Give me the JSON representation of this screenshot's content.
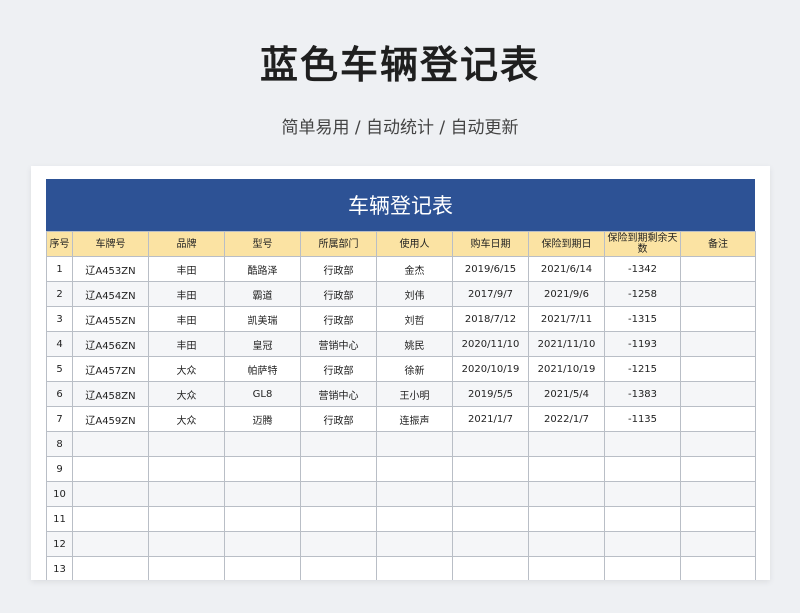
{
  "page": {
    "title": "蓝色车辆登记表",
    "subtitle": "简单易用 / 自动统计 / 自动更新"
  },
  "sheet": {
    "banner": "车辆登记表",
    "headers": [
      "序号",
      "车牌号",
      "品牌",
      "型号",
      "所属部门",
      "使用人",
      "购车日期",
      "保险到期日",
      "保险到期剩余天数",
      "备注"
    ],
    "rows": [
      [
        "1",
        "辽A453ZN",
        "丰田",
        "酷路泽",
        "行政部",
        "金杰",
        "2019/6/15",
        "2021/6/14",
        "-1342",
        ""
      ],
      [
        "2",
        "辽A454ZN",
        "丰田",
        "霸道",
        "行政部",
        "刘伟",
        "2017/9/7",
        "2021/9/6",
        "-1258",
        ""
      ],
      [
        "3",
        "辽A455ZN",
        "丰田",
        "凯美瑞",
        "行政部",
        "刘哲",
        "2018/7/12",
        "2021/7/11",
        "-1315",
        ""
      ],
      [
        "4",
        "辽A456ZN",
        "丰田",
        "皇冠",
        "营销中心",
        "姚民",
        "2020/11/10",
        "2021/11/10",
        "-1193",
        ""
      ],
      [
        "5",
        "辽A457ZN",
        "大众",
        "帕萨特",
        "行政部",
        "徐新",
        "2020/10/19",
        "2021/10/19",
        "-1215",
        ""
      ],
      [
        "6",
        "辽A458ZN",
        "大众",
        "GL8",
        "营销中心",
        "王小明",
        "2019/5/5",
        "2021/5/4",
        "-1383",
        ""
      ],
      [
        "7",
        "辽A459ZN",
        "大众",
        "迈腾",
        "行政部",
        "连振声",
        "2021/1/7",
        "2022/1/7",
        "-1135",
        ""
      ],
      [
        "8",
        "",
        "",
        "",
        "",
        "",
        "",
        "",
        "",
        ""
      ],
      [
        "9",
        "",
        "",
        "",
        "",
        "",
        "",
        "",
        "",
        ""
      ],
      [
        "10",
        "",
        "",
        "",
        "",
        "",
        "",
        "",
        "",
        ""
      ],
      [
        "11",
        "",
        "",
        "",
        "",
        "",
        "",
        "",
        "",
        ""
      ],
      [
        "12",
        "",
        "",
        "",
        "",
        "",
        "",
        "",
        "",
        ""
      ],
      [
        "13",
        "",
        "",
        "",
        "",
        "",
        "",
        "",
        "",
        ""
      ]
    ]
  }
}
